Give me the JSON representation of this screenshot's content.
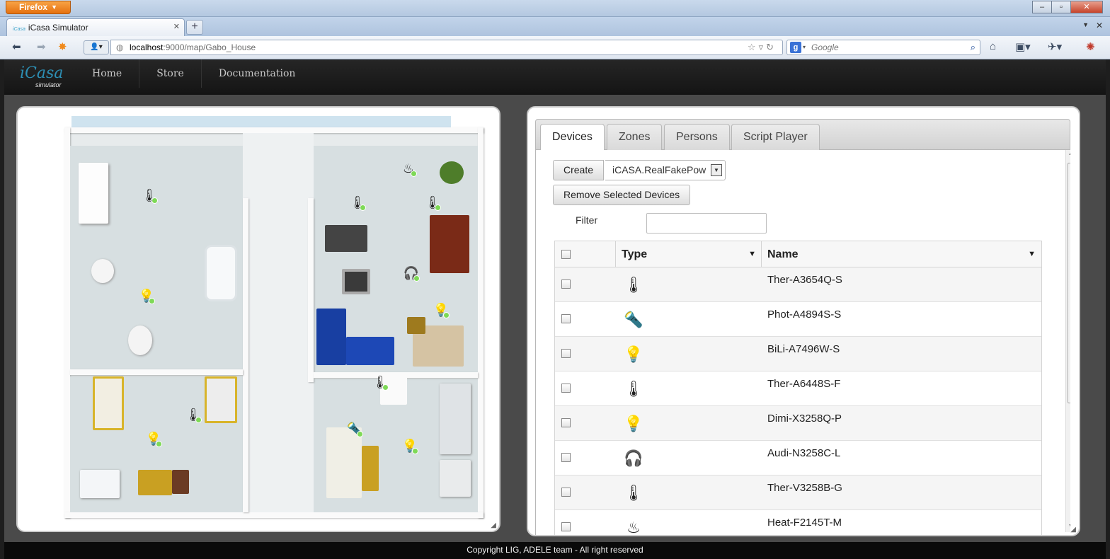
{
  "browser": {
    "app_button": "Firefox",
    "tab_title": "iCasa Simulator",
    "favicon_text": "iCasa",
    "url_host": "localhost",
    "url_rest": ":9000/map/Gabo_House",
    "search_engine_letter": "g",
    "search_placeholder": "Google",
    "window_controls": [
      "–",
      "▫",
      "✕"
    ]
  },
  "app": {
    "logo_main": "iCasa",
    "logo_sub": "simulator",
    "menu": [
      "Home",
      "Store",
      "Documentation"
    ]
  },
  "panel": {
    "tabs": [
      "Devices",
      "Zones",
      "Persons",
      "Script Player"
    ],
    "active_tab": "Devices",
    "create_label": "Create",
    "create_select_value": "iCASA.RealFakePow",
    "remove_label": "Remove Selected Devices",
    "filter_label": "Filter",
    "filter_value": "",
    "columns": {
      "type": "Type",
      "name": "Name"
    },
    "devices": [
      {
        "name": "Ther-A3654Q-S",
        "icon": "thermometer-icon",
        "glyph": "🌡"
      },
      {
        "name": "Phot-A4894S-S",
        "icon": "photometer-icon",
        "glyph": "🔦"
      },
      {
        "name": "BiLi-A7496W-S",
        "icon": "bulb-icon",
        "glyph": "💡"
      },
      {
        "name": "Ther-A6448S-F",
        "icon": "thermometer-icon",
        "glyph": "🌡"
      },
      {
        "name": "Dimi-X3258Q-P",
        "icon": "dimmer-bulb-icon",
        "glyph": "💡"
      },
      {
        "name": "Audi-N3258C-L",
        "icon": "audio-icon",
        "glyph": "🎧"
      },
      {
        "name": "Ther-V3258B-G",
        "icon": "thermometer-icon",
        "glyph": "🌡"
      },
      {
        "name": "Heat-F2145T-M",
        "icon": "heater-icon",
        "glyph": "♨"
      }
    ]
  },
  "footer": "Copyright LIG, ADELE team - All right reserved"
}
